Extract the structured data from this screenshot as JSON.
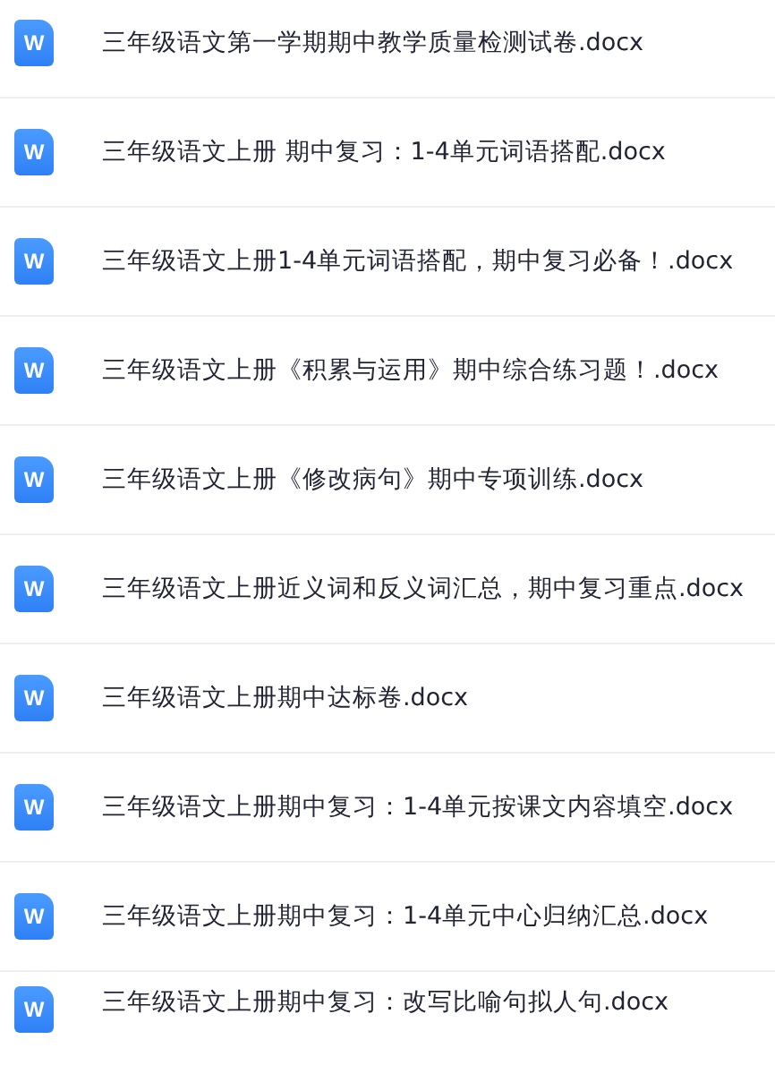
{
  "files": [
    {
      "icon_glyph": "W",
      "name": "三年级语文第一学期期中教学质量检测试卷.docx"
    },
    {
      "icon_glyph": "W",
      "name": "三年级语文上册 期中复习：1-4单元词语搭配.docx"
    },
    {
      "icon_glyph": "W",
      "name": "三年级语文上册1-4单元词语搭配，期中复习必备！.docx"
    },
    {
      "icon_glyph": "W",
      "name": "三年级语文上册《积累与运用》期中综合练习题！.docx"
    },
    {
      "icon_glyph": "W",
      "name": "三年级语文上册《修改病句》期中专项训练.docx"
    },
    {
      "icon_glyph": "W",
      "name": "三年级语文上册近义词和反义词汇总，期中复习重点.docx"
    },
    {
      "icon_glyph": "W",
      "name": "三年级语文上册期中达标卷.docx"
    },
    {
      "icon_glyph": "W",
      "name": "三年级语文上册期中复习：1-4单元按课文内容填空.docx"
    },
    {
      "icon_glyph": "W",
      "name": "三年级语文上册期中复习：1-4单元中心归纳汇总.docx"
    },
    {
      "icon_glyph": "W",
      "name": "三年级语文上册期中复习：改写比喻句拟人句.docx"
    }
  ]
}
